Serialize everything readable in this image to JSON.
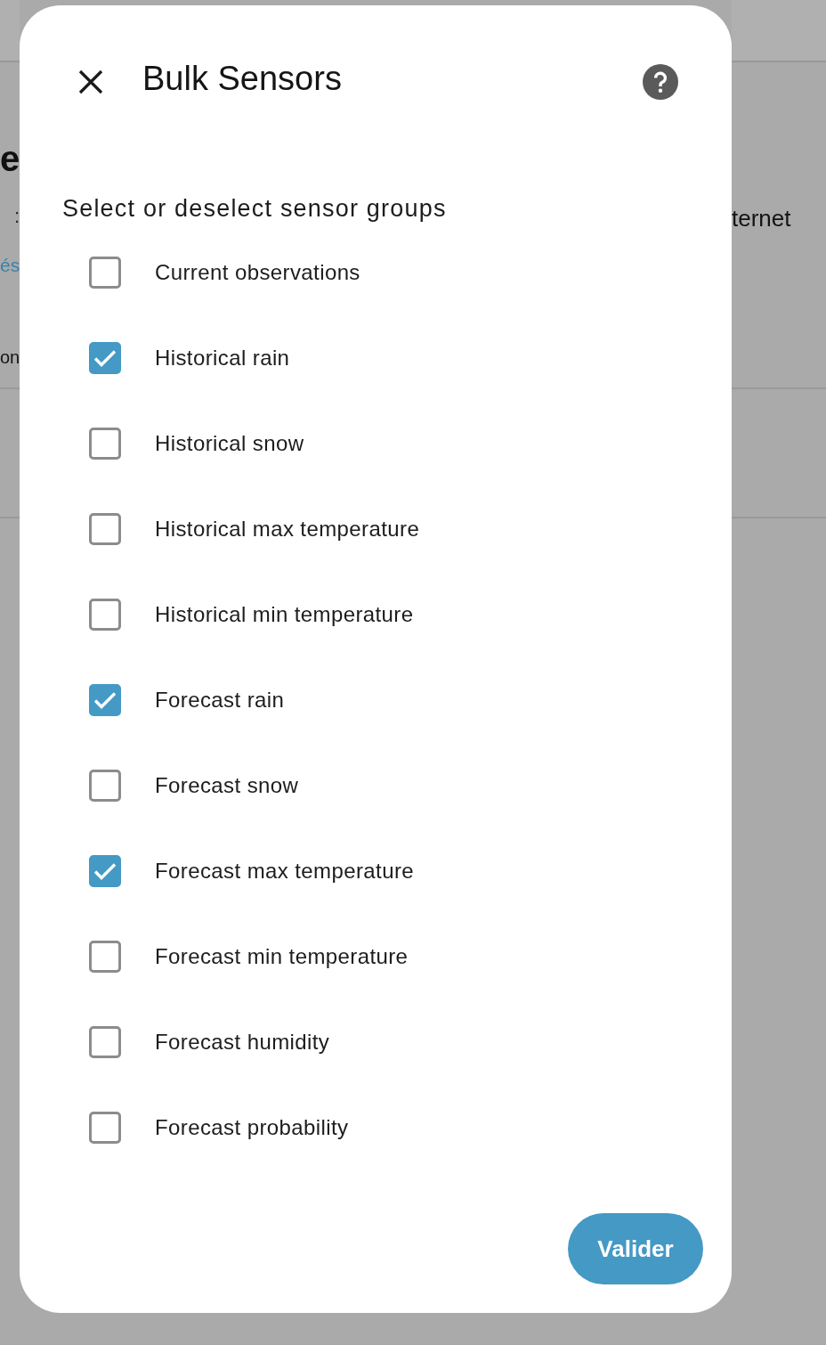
{
  "background_page": {
    "left_edge_texts": [
      {
        "text": "e",
        "kind": "heading"
      },
      {
        "text": ":",
        "kind": "meta"
      },
      {
        "text": "és",
        "kind": "link"
      },
      {
        "text": "on",
        "kind": "body"
      }
    ],
    "right_edge_texts": [
      {
        "text": "ternet",
        "kind": "body"
      }
    ]
  },
  "dialog": {
    "title": "Bulk Sensors",
    "subtitle": "Select or deselect sensor groups",
    "sensor_groups": [
      {
        "label": "Current observations",
        "checked": false
      },
      {
        "label": "Historical rain",
        "checked": true
      },
      {
        "label": "Historical snow",
        "checked": false
      },
      {
        "label": "Historical max temperature",
        "checked": false
      },
      {
        "label": "Historical min temperature",
        "checked": false
      },
      {
        "label": "Forecast rain",
        "checked": true
      },
      {
        "label": "Forecast snow",
        "checked": false
      },
      {
        "label": "Forecast max temperature",
        "checked": true
      },
      {
        "label": "Forecast min temperature",
        "checked": false
      },
      {
        "label": "Forecast humidity",
        "checked": false
      },
      {
        "label": "Forecast probability",
        "checked": false
      }
    ],
    "confirm_button": "Valider"
  }
}
